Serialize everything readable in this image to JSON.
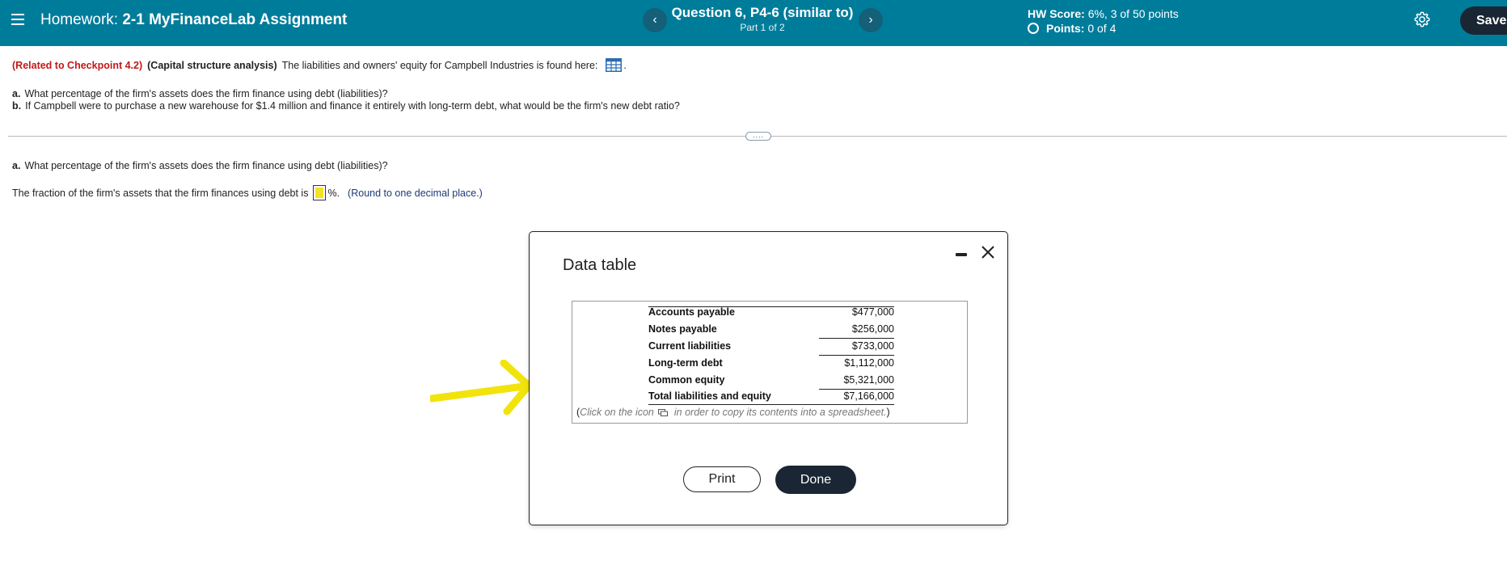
{
  "header": {
    "homework_prefix": "Homework:",
    "assignment_name": "2-1 MyFinanceLab Assignment",
    "question_title": "Question 6, P4-6 (similar to)",
    "question_part": "Part 1 of 2",
    "prev_glyph": "‹",
    "next_glyph": "›",
    "hw_score_label": "HW Score:",
    "hw_score_value": "6%, 3 of 50 points",
    "points_label": "Points:",
    "points_value": "0 of 4",
    "save_label": "Save",
    "colors": {
      "bar": "#007c9b",
      "dark_button": "#1a2633"
    }
  },
  "question": {
    "related": "(Related to Checkpoint 4.2)",
    "topic": "(Capital structure analysis)",
    "intro_text": "The liabilities and owners' equity for Campbell Industries is found here:",
    "intro_suffix": ".",
    "part_a_letter": "a.",
    "part_a_text": "What percentage of the firm's assets does the firm finance using debt (liabilities)?",
    "part_b_letter": "b.",
    "part_b_text": "If Campbell were to purchase a new warehouse for $1.4 million and finance it entirely with long-term debt, what would be the firm's new debt ratio?",
    "divider_handle": "....",
    "answer_heading_letter": "a.",
    "answer_heading_text": "What percentage of the firm's assets does the firm finance using debt (liabilities)?",
    "answer_prefix": "The fraction of the firm's assets that the firm finances using debt is",
    "answer_value": "",
    "answer_suffix": "%.",
    "round_note": "(Round to one decimal place.)"
  },
  "dialog": {
    "title": "Data table",
    "rows": [
      {
        "label": "Accounts payable",
        "value": "$477,000"
      },
      {
        "label": "Notes payable",
        "value": "$256,000"
      },
      {
        "label": "Current liabilities",
        "value": "$733,000"
      },
      {
        "label": "Long-term debt",
        "value": "$1,112,000"
      },
      {
        "label": "Common equity",
        "value": "$5,321,000"
      },
      {
        "label": "Total liabilities and equity",
        "value": "$7,166,000"
      }
    ],
    "copy_note_open": "(",
    "copy_note_a": "Click on the icon",
    "copy_note_b": "in order to copy its contents into a spreadsheet.",
    "copy_note_close": ")",
    "print_label": "Print",
    "done_label": "Done"
  },
  "annotation": {
    "arrow_color": "#f2e30c"
  }
}
